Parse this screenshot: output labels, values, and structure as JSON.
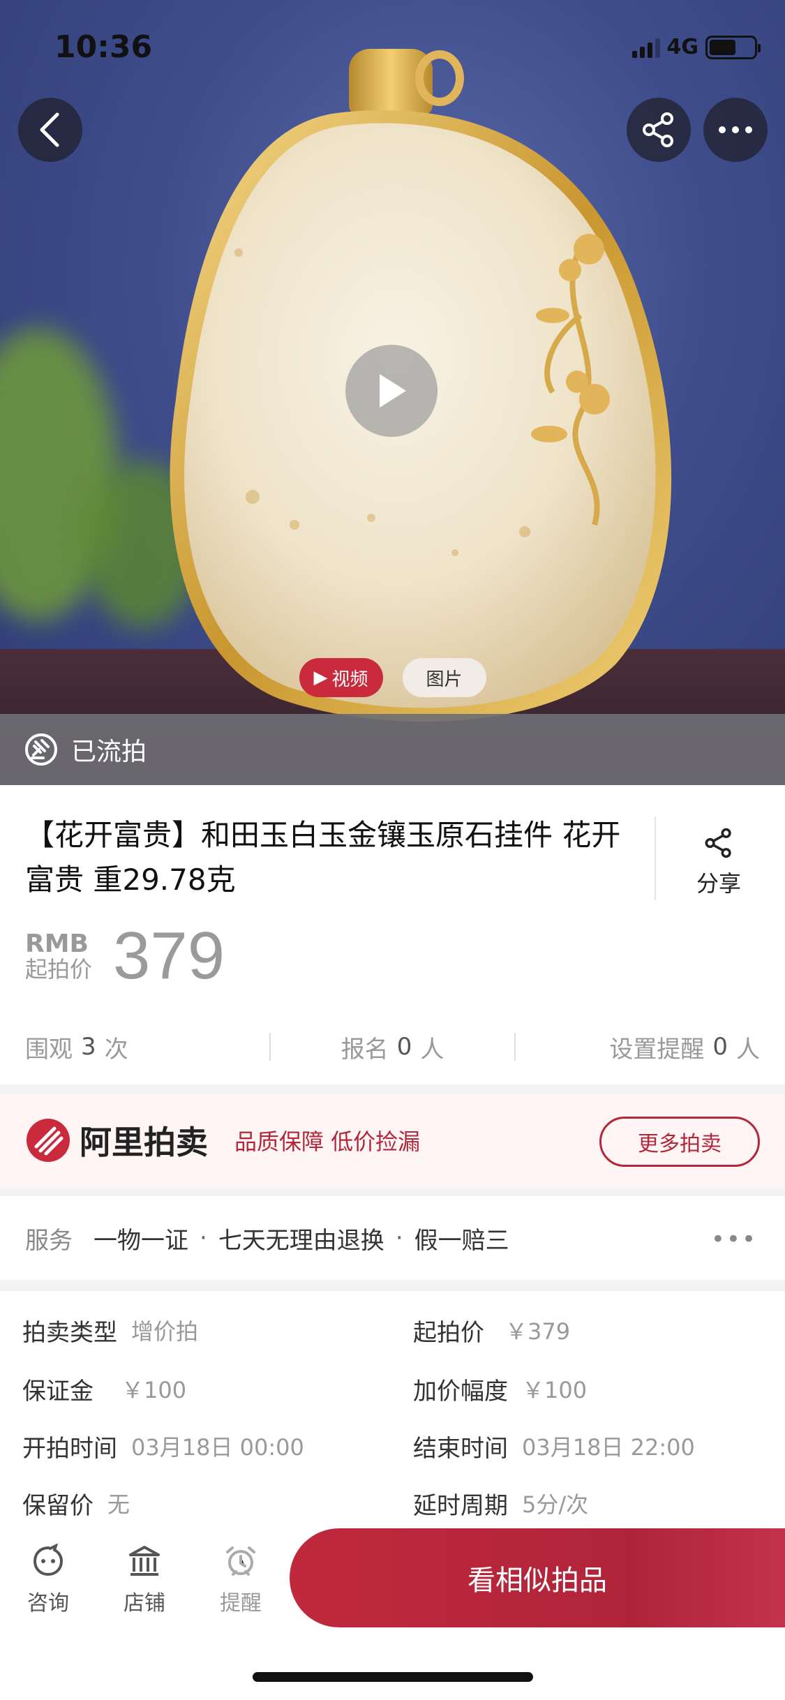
{
  "status_bar": {
    "time": "10:36",
    "network": "4G"
  },
  "hero": {
    "media_tabs": {
      "video": "视频",
      "photo": "图片"
    },
    "auction_status": "已流拍"
  },
  "product": {
    "title": "【花开富贵】和田玉白玉金镶玉原石挂件 花开富贵 重29.78克",
    "share_label": "分享",
    "price_currency": "RMB",
    "price_label": "起拍价",
    "price_value": "379"
  },
  "stats": {
    "views_label": "围观",
    "views_value": "3",
    "views_unit": "次",
    "signup_label": "报名",
    "signup_value": "0",
    "signup_unit": "人",
    "reminder_label": "设置提醒",
    "reminder_value": "0",
    "reminder_unit": "人"
  },
  "banner": {
    "brand": "阿里拍卖",
    "slogan": "品质保障 低价捡漏",
    "more_button": "更多拍卖",
    "accent_color": "#b2283a"
  },
  "services": {
    "label": "服务",
    "items": [
      "一物一证",
      "七天无理由退换",
      "假一赔三"
    ],
    "separator": "·",
    "more": "•••"
  },
  "details": {
    "rows": [
      {
        "left_key": "拍卖类型",
        "left_value": "增价拍",
        "right_key": "起拍价",
        "right_value": "￥379"
      },
      {
        "left_key": "保证金",
        "left_value": "￥100",
        "right_key": "加价幅度",
        "right_value": "￥100"
      },
      {
        "left_key": "开拍时间",
        "left_value": "03月18日 00:00",
        "right_key": "结束时间",
        "right_value": "03月18日 22:00"
      },
      {
        "left_key": "保留价",
        "left_value": "无",
        "right_key": "延时周期",
        "right_value": "5分/次"
      }
    ]
  },
  "bottom_bar": {
    "consult": "咨询",
    "shop": "店铺",
    "remind": "提醒",
    "cta": "看相似拍品"
  }
}
